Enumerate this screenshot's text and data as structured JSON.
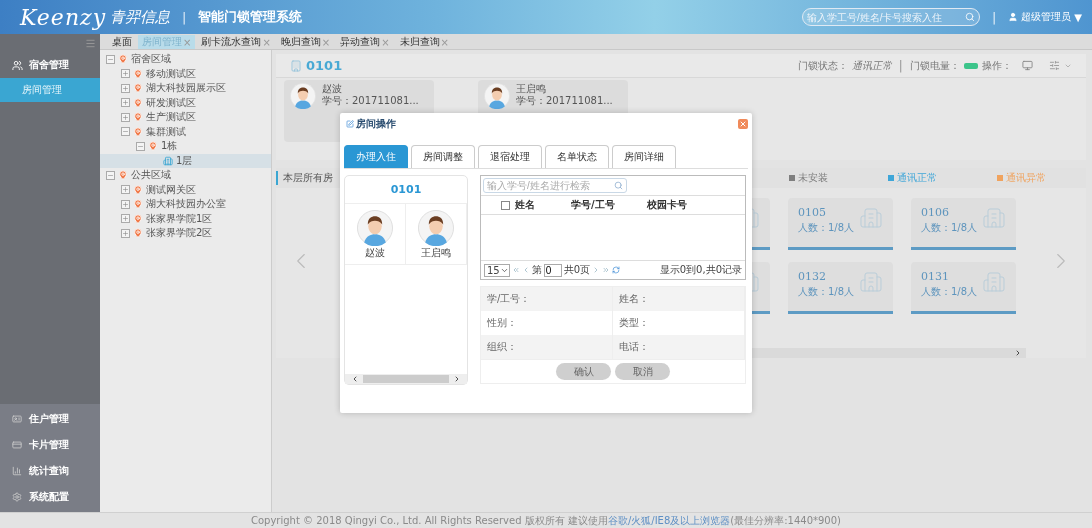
{
  "header": {
    "brand": "Keenzy",
    "brand_cn": "青羿信息",
    "separator": "|",
    "system_title": "智能门锁管理系统",
    "search": {
      "placeholder": "输入学工号/姓名/卡号搜索入住"
    },
    "user": "超级管理员",
    "user_caret": "▼"
  },
  "page_tabs": [
    {
      "label": "桌面",
      "selected": false
    },
    {
      "label": "房间管理",
      "close": "×",
      "selected": true
    },
    {
      "label": "刷卡流水查询",
      "close": "×",
      "selected": false
    },
    {
      "label": "晚归查询",
      "close": "×",
      "selected": false
    },
    {
      "label": "异动查询",
      "close": "×",
      "selected": false
    },
    {
      "label": "未归查询",
      "close": "×",
      "selected": false
    }
  ],
  "sidebar": {
    "groups": [
      {
        "label": "宿舍管理",
        "children": [
          {
            "label": "房间管理",
            "selected": true
          }
        ]
      }
    ],
    "bottom_items": [
      {
        "label": "住户管理"
      },
      {
        "label": "卡片管理"
      },
      {
        "label": "统计查询"
      },
      {
        "label": "系统配置"
      }
    ]
  },
  "tree": [
    {
      "label": "宿舍区域",
      "kind": "area",
      "expanded": true,
      "selected": false,
      "children": [
        {
          "label": "移动测试区",
          "kind": "area",
          "expanded": false,
          "selected": false
        },
        {
          "label": "湖大科技园展示区",
          "kind": "area",
          "expanded": false,
          "selected": false
        },
        {
          "label": "研发测试区",
          "kind": "area",
          "expanded": false,
          "selected": false
        },
        {
          "label": "生产测试区",
          "kind": "area",
          "expanded": false,
          "selected": false
        },
        {
          "label": "集群测试",
          "kind": "area",
          "expanded": true,
          "selected": false,
          "children": [
            {
              "label": "1栋",
              "kind": "area",
              "expanded": true,
              "selected": false,
              "children": [
                {
                  "label": "1层",
                  "kind": "floor",
                  "selected": true
                }
              ]
            }
          ]
        }
      ]
    },
    {
      "label": "公共区域",
      "kind": "area",
      "expanded": true,
      "selected": false,
      "children": [
        {
          "label": "测试网关区",
          "kind": "area",
          "expanded": false,
          "selected": false
        },
        {
          "label": "湖大科技园办公室",
          "kind": "area",
          "expanded": false,
          "selected": false
        },
        {
          "label": "张家界学院1区",
          "kind": "area",
          "expanded": false,
          "selected": false
        },
        {
          "label": "张家界学院2区",
          "kind": "area",
          "expanded": false,
          "selected": false
        }
      ]
    }
  ],
  "room": {
    "title": "0101",
    "lock_status_label": "门锁状态：",
    "lock_status": "通讯正常",
    "separator": "|",
    "battery_label": "门锁电量：",
    "operate_label": "操作："
  },
  "residents": [
    {
      "name": "赵波",
      "student_id": "学号：201711081..."
    },
    {
      "name": "王启鸣",
      "student_id": "学号：201711081..."
    }
  ],
  "floor_note": "本层所有房",
  "legend": [
    {
      "label": "未安装",
      "color": "#7f7f7f"
    },
    {
      "label": "通讯正常",
      "color": "#3fa6d8"
    },
    {
      "label": "通讯异常",
      "color": "#f0a35e"
    }
  ],
  "rooms": [
    [
      {
        "kind": "partial"
      },
      {
        "kind": "room",
        "number": "0105",
        "occupancy": "人数：1/8人"
      },
      {
        "kind": "room",
        "number": "0106",
        "occupancy": "人数：1/8人"
      }
    ],
    [
      {
        "kind": "partial"
      },
      {
        "kind": "room",
        "number": "0132",
        "occupancy": "人数：1/8人"
      },
      {
        "kind": "room",
        "number": "0131",
        "occupancy": "人数：1/8人"
      }
    ]
  ],
  "modal": {
    "title": "房间操作",
    "tabs": [
      {
        "label": "办理入住",
        "selected": true
      },
      {
        "label": "房间调整",
        "selected": false
      },
      {
        "label": "退宿处理",
        "selected": false
      },
      {
        "label": "名单状态",
        "selected": false
      },
      {
        "label": "房间详细",
        "selected": false
      }
    ],
    "room": "0101",
    "occupants": [
      {
        "name": "赵波"
      },
      {
        "name": "王启鸣"
      }
    ],
    "search": {
      "placeholder": "输入学号/姓名进行检索"
    },
    "table": {
      "select_all": {
        "checked": false
      },
      "columns": [
        "姓名",
        "学号/工号",
        "校园卡号"
      ]
    },
    "pager": {
      "page_size": "15",
      "page_prefix": "第",
      "page": "0",
      "total_pages": "共0页",
      "summary": "显示0到0,共0记录"
    },
    "details": [
      {
        "label": "学/工号："
      },
      {
        "label": "姓名："
      },
      {
        "label": "性别："
      },
      {
        "label": "类型："
      },
      {
        "label": "组织："
      },
      {
        "label": "电话："
      }
    ],
    "buttons": [
      "确认",
      "取消"
    ]
  },
  "footer": {
    "text": "Copyright © 2018 Qingyi Co., Ltd. All Rights Reserved 版权所有 建议使用",
    "link": "谷歌/火狐/IE8及以上浏览器",
    "note": "(最佳分辨率:1440*900)"
  }
}
